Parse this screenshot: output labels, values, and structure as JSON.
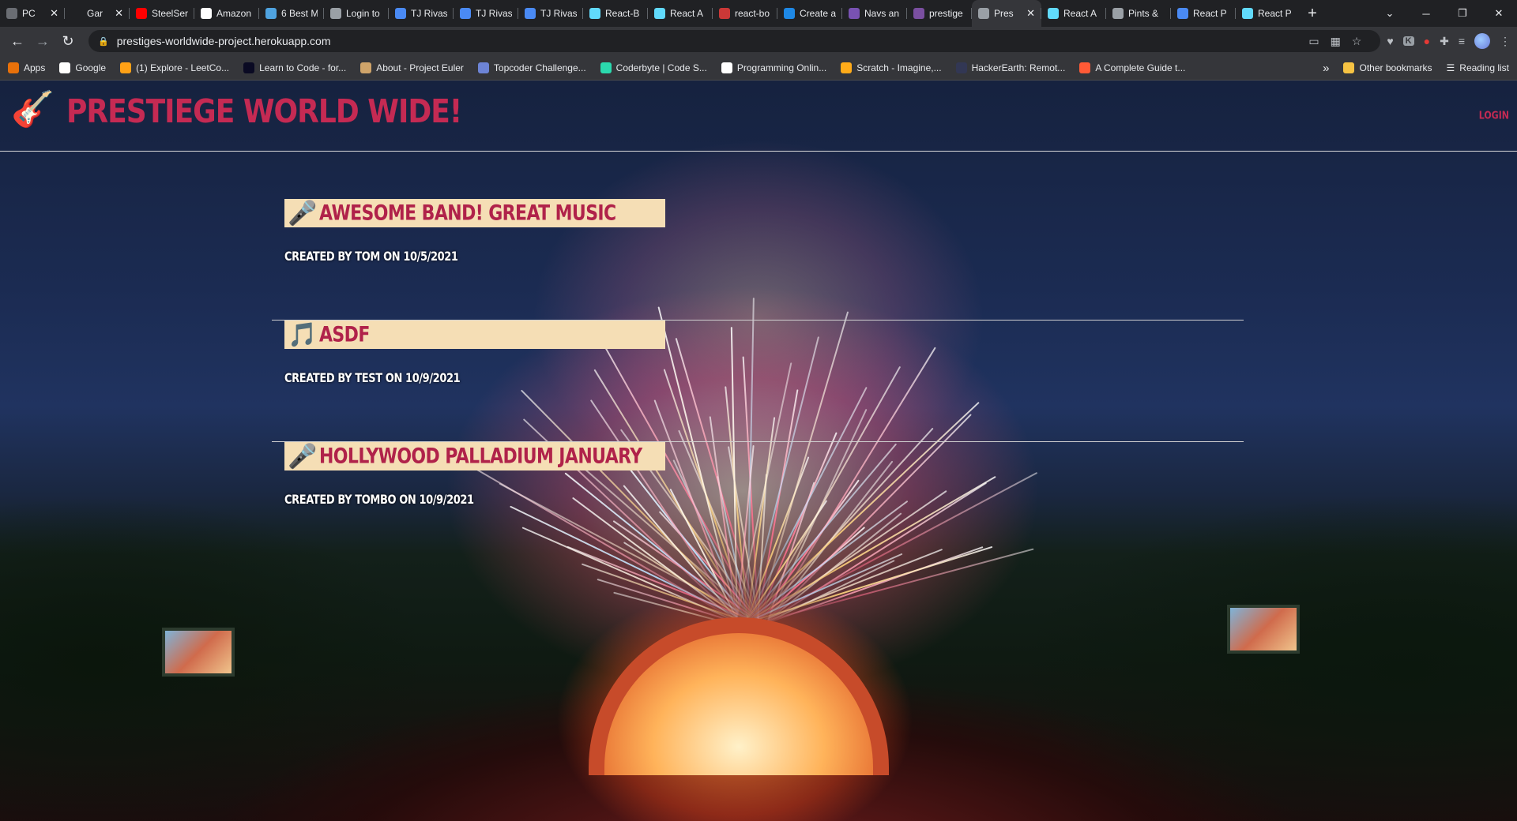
{
  "browser": {
    "tabs": [
      {
        "title": "PC",
        "color": "#6a6d73"
      },
      {
        "title": "Gar",
        "color": "#202124"
      },
      {
        "title": "SteelSer",
        "color": "#ff0000"
      },
      {
        "title": "Amazon",
        "color": "#ffffff"
      },
      {
        "title": "6 Best M",
        "color": "#4fa3e0"
      },
      {
        "title": "Login to",
        "color": "#9aa0a6"
      },
      {
        "title": "TJ Rivas",
        "color": "#4a8af4"
      },
      {
        "title": "TJ Rivas",
        "color": "#4a8af4"
      },
      {
        "title": "TJ Rivas",
        "color": "#4a8af4"
      },
      {
        "title": "React-B",
        "color": "#61dafb"
      },
      {
        "title": "React A",
        "color": "#61dafb"
      },
      {
        "title": "react-bo",
        "color": "#cb3837"
      },
      {
        "title": "Create a",
        "color": "#1e88e5"
      },
      {
        "title": "Navs an",
        "color": "#7952b3"
      },
      {
        "title": "prestige",
        "color": "#7a4fa0"
      },
      {
        "title": "Pres",
        "color": "#9aa0a6",
        "active": true
      },
      {
        "title": "React A",
        "color": "#61dafb"
      },
      {
        "title": "Pints &",
        "color": "#9aa0a6"
      },
      {
        "title": "React P",
        "color": "#4a8af4"
      },
      {
        "title": "React P",
        "color": "#61dafb"
      }
    ],
    "new_tab": "+",
    "url": "prestiges-worldwide-project.herokuapp.com",
    "bookmarks": [
      {
        "label": "Apps",
        "color": "#e8710a"
      },
      {
        "label": "Google",
        "color": "#ffffff"
      },
      {
        "label": "(1) Explore - LeetCo...",
        "color": "#ffa116"
      },
      {
        "label": "Learn to Code - for...",
        "color": "#0a0a23"
      },
      {
        "label": "About - Project Euler",
        "color": "#cfa46a"
      },
      {
        "label": "Topcoder Challenge...",
        "color": "#6d84d6"
      },
      {
        "label": "Coderbyte | Code S...",
        "color": "#2bd9ae"
      },
      {
        "label": "Programming Onlin...",
        "color": "#ffffff"
      },
      {
        "label": "Scratch - Imagine,...",
        "color": "#ffab19"
      },
      {
        "label": "HackerEarth: Remot...",
        "color": "#323754"
      },
      {
        "label": "A Complete Guide t...",
        "color": "#ff5a36"
      }
    ],
    "overflow": "»",
    "other_bookmarks": "Other bookmarks",
    "reading_list": "Reading list"
  },
  "site": {
    "title": "Prestiege World Wide!",
    "logo_icon": "🎸",
    "login": "Login"
  },
  "posts": [
    {
      "icon": "🎤",
      "title": "Awesome Band! Great Music",
      "meta": "Created by Tom on 10/5/2021"
    },
    {
      "icon": "🎵",
      "title": "asdf",
      "meta": "Created by test on 10/9/2021"
    },
    {
      "icon": "🎤",
      "title": "Hollywood Palladium January",
      "meta": "Created by Tombo on 10/9/2021"
    }
  ],
  "colors": {
    "title_red": "#c52a53",
    "post_title_bg": "#f5deb5",
    "post_title_text": "#b0224a"
  }
}
